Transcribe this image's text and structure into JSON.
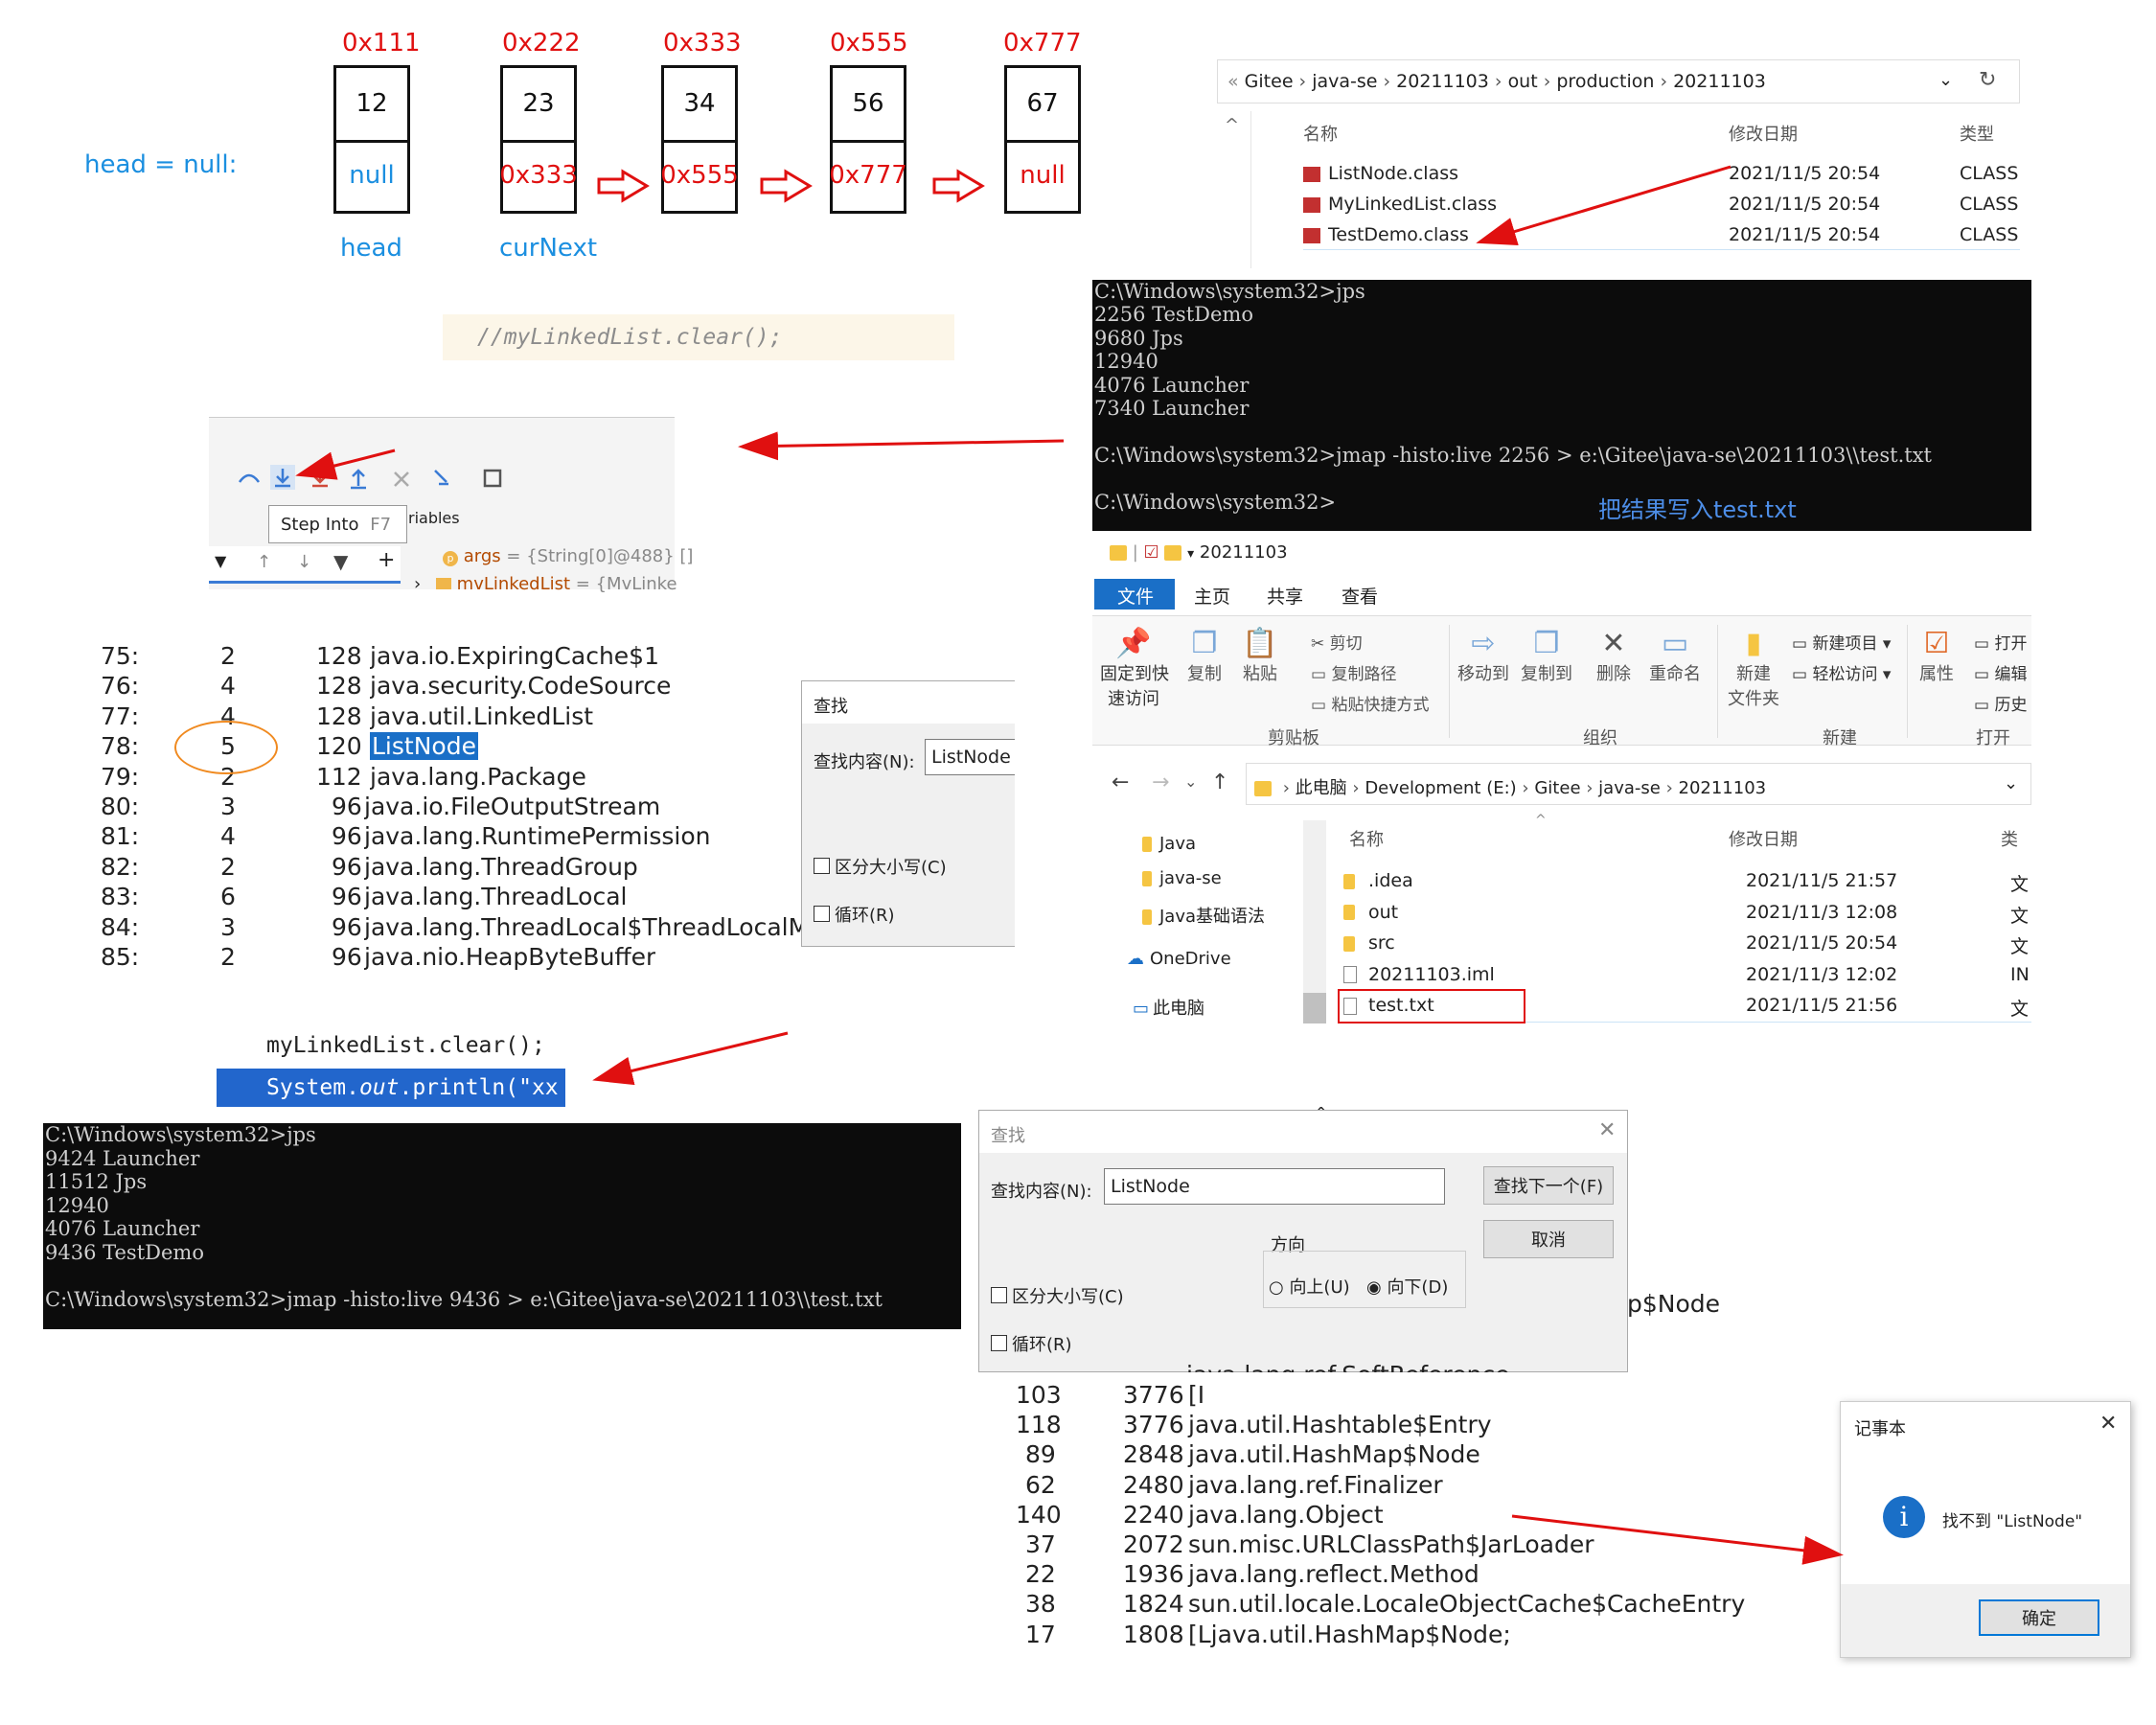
{
  "linked_list": {
    "head_eq_null": "head = null:",
    "nodes": [
      {
        "addr": "0x111",
        "val": "12",
        "next": "null"
      },
      {
        "addr": "0x222",
        "val": "23",
        "next": "0x333"
      },
      {
        "addr": "0x333",
        "val": "34",
        "next": "0x555"
      },
      {
        "addr": "0x555",
        "val": "56",
        "next": "0x777"
      },
      {
        "addr": "0x777",
        "val": "67",
        "next": "null"
      }
    ],
    "head_label": "head",
    "curnext_label": "curNext"
  },
  "code_comment": "//myLinkedList.clear();",
  "debugger": {
    "tooltip": "Step Into",
    "shortcut": "F7",
    "variables_frag": "riables",
    "var1_name": "args",
    "var1_val": "= {String[0]@488} []",
    "var2_name": "mvLinkedList",
    "var2_val": "= {MvLinke"
  },
  "heap_rows": [
    {
      "ln": "75:",
      "n": "2",
      "sz": "128",
      "cls": "java.io.ExpiringCache$1"
    },
    {
      "ln": "76:",
      "n": "4",
      "sz": "128",
      "cls": "java.security.CodeSource"
    },
    {
      "ln": "77:",
      "n": "4",
      "sz": "128",
      "cls": "java.util.LinkedList"
    },
    {
      "ln": "78:",
      "n": "5",
      "sz": "120",
      "cls": "ListNode"
    },
    {
      "ln": "79:",
      "n": "2",
      "sz": "112",
      "cls": "java.lang.Package"
    },
    {
      "ln": "80:",
      "n": "3",
      "sz": "96",
      "cls": "java.io.FileOutputStream"
    },
    {
      "ln": "81:",
      "n": "4",
      "sz": "96",
      "cls": "java.lang.RuntimePermission"
    },
    {
      "ln": "82:",
      "n": "2",
      "sz": "96",
      "cls": "java.lang.ThreadGroup"
    },
    {
      "ln": "83:",
      "n": "6",
      "sz": "96",
      "cls": "java.lang.ThreadLocal"
    },
    {
      "ln": "84:",
      "n": "3",
      "sz": "96",
      "cls": "java.lang.ThreadLocal$ThreadLocalMap$"
    },
    {
      "ln": "85:",
      "n": "2",
      "sz": "96",
      "cls": "java.nio.HeapByteBuffer"
    }
  ],
  "find_small": {
    "title": "查找",
    "label": "查找内容(N):",
    "value": "ListNode",
    "case": "区分大小写(C)",
    "loop": "循环(R)"
  },
  "code2": {
    "line1": "myLinkedList.clear();",
    "line2a": "System.",
    "line2b": "out",
    "line2c": ".println(\"xx"
  },
  "term_top": "C:\\Windows\\system32>jps\n2256 TestDemo\n9680 Jps\n12940\n4076 Launcher\n7340 Launcher\n\nC:\\Windows\\system32>jmap -histo:live 2256 > e:\\Gitee\\java-se\\20211103\\\\test.txt\n\nC:\\Windows\\system32>",
  "term_top_note": "把结果写入test.txt",
  "term_bottom": "C:\\Windows\\system32>jps\n9424 Launcher\n11512 Jps\n12940\n4076 Launcher\n9436 TestDemo\n\nC:\\Windows\\system32>jmap -histo:live 9436 > e:\\Gitee\\java-se\\20211103\\\\test.txt",
  "explorer_top": {
    "crumbs": [
      "Gitee",
      "java-se",
      "20211103",
      "out",
      "production",
      "20211103"
    ],
    "col_name": "名称",
    "col_date": "修改日期",
    "col_type": "类型",
    "files": [
      {
        "name": "ListNode.class",
        "date": "2021/11/5 20:54",
        "type": "CLASS"
      },
      {
        "name": "MyLinkedList.class",
        "date": "2021/11/5 20:54",
        "type": "CLASS"
      },
      {
        "name": "TestDemo.class",
        "date": "2021/11/5 20:54",
        "type": "CLASS"
      }
    ]
  },
  "explorer_main": {
    "title": "20211103",
    "tabs": [
      "文件",
      "主页",
      "共享",
      "查看"
    ],
    "ribbon": {
      "pin": "固定到快\n速访问",
      "copy": "复制",
      "paste": "粘贴",
      "cut": "剪切",
      "copypath": "复制路径",
      "pasteshortcut": "粘贴快捷方式",
      "clipboard": "剪贴板",
      "moveto": "移动到",
      "copyto": "复制到",
      "delete": "删除",
      "rename": "重命名",
      "organize": "组织",
      "newfolder": "新建\n文件夹",
      "newitem": "新建项目",
      "easyaccess": "轻松访问",
      "new": "新建",
      "props": "属性",
      "open": "打开",
      "edit": "编辑",
      "history": "历史",
      "opengroup": "打开"
    },
    "crumbs": [
      "此电脑",
      "Development (E:)",
      "Gitee",
      "java-se",
      "20211103"
    ],
    "nav": [
      "Java",
      "java-se",
      "Java基础语法",
      "OneDrive",
      "此电脑"
    ],
    "col_name": "名称",
    "col_date": "修改日期",
    "col_type": "类",
    "files": [
      {
        "name": ".idea",
        "date": "2021/11/5 21:57",
        "type": "文"
      },
      {
        "name": "out",
        "date": "2021/11/3 12:08",
        "type": "文"
      },
      {
        "name": "src",
        "date": "2021/11/5 20:54",
        "type": "文"
      },
      {
        "name": "20211103.iml",
        "date": "2021/11/3 12:02",
        "type": "IN"
      },
      {
        "name": "test.txt",
        "date": "2021/11/5 21:56",
        "type": "文"
      }
    ]
  },
  "find_big": {
    "title": "查找",
    "label": "查找内容(N):",
    "value": "ListNode",
    "findnext": "查找下一个(F)",
    "cancel": "取消",
    "direction": "方向",
    "up": "向上(U)",
    "down": "向下(D)",
    "case": "区分大小写(C)",
    "loop": "循环(R)"
  },
  "bottom_rows": [
    {
      "n": "103",
      "sz": "3776",
      "cls": "[I"
    },
    {
      "n": "118",
      "sz": "3776",
      "cls": "java.util.Hashtable$Entry"
    },
    {
      "n": "89",
      "sz": "2848",
      "cls": "java.util.HashMap$Node"
    },
    {
      "n": "62",
      "sz": "2480",
      "cls": "java.lang.ref.Finalizer"
    },
    {
      "n": "140",
      "sz": "2240",
      "cls": "java.lang.Object"
    },
    {
      "n": "37",
      "sz": "2072",
      "cls": "sun.misc.URLClassPath$JarLoader"
    },
    {
      "n": "22",
      "sz": "1936",
      "cls": "java.lang.reflect.Method"
    },
    {
      "n": "38",
      "sz": "1824",
      "cls": "sun.util.locale.LocaleObjectCache$CacheEntry"
    },
    {
      "n": "17",
      "sz": "1808",
      "cls": "[Ljava.util.HashMap$Node;"
    }
  ],
  "bottom_frag1": "p$Node",
  "bottom_frag2": "java.lang.ref.SoftReference",
  "notepad": {
    "title": "记事本",
    "message": "找不到 \"ListNode\"",
    "ok": "确定"
  }
}
